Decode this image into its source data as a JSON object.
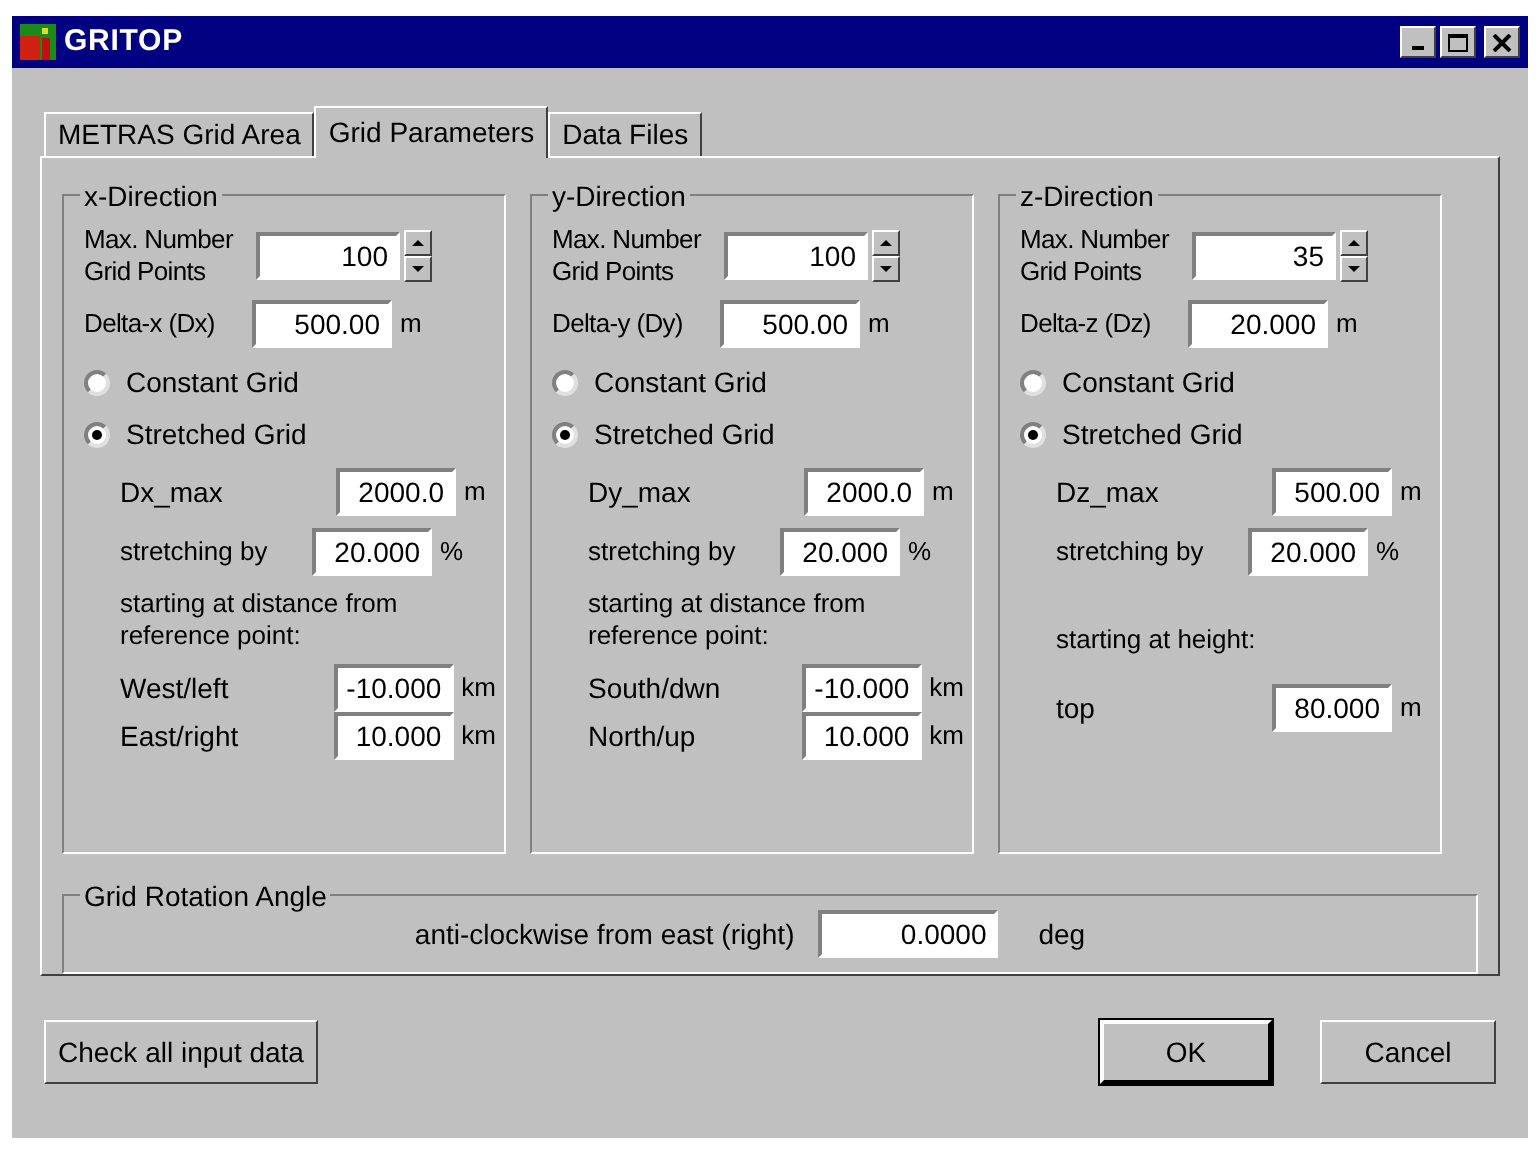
{
  "window": {
    "title": "GRITOP"
  },
  "tabs": [
    {
      "label": "METRAS Grid Area",
      "selected": false
    },
    {
      "label": "Grid Parameters",
      "selected": true
    },
    {
      "label": "Data Files",
      "selected": false
    }
  ],
  "directions": [
    {
      "title": "x-Direction",
      "max_label": "Max. Number Grid Points",
      "max_value": "100",
      "delta_label": "Delta-x (Dx)",
      "delta_value": "500.00",
      "delta_unit": "m",
      "grid_options": [
        {
          "label": "Constant Grid",
          "selected": false
        },
        {
          "label": "Stretched Grid",
          "selected": true
        }
      ],
      "dmax_label": "Dx_max",
      "dmax_value": "2000.0",
      "dmax_unit": "m",
      "stretch_label": "stretching by",
      "stretch_value": "20.000",
      "stretch_unit": "%",
      "start_text": "starting at distance from reference point:",
      "rows": [
        {
          "label": "West/left",
          "value": "-10.000",
          "unit": "km"
        },
        {
          "label": "East/right",
          "value": "10.000",
          "unit": "km"
        }
      ]
    },
    {
      "title": "y-Direction",
      "max_label": "Max. Number Grid Points",
      "max_value": "100",
      "delta_label": "Delta-y (Dy)",
      "delta_value": "500.00",
      "delta_unit": "m",
      "grid_options": [
        {
          "label": "Constant Grid",
          "selected": false
        },
        {
          "label": "Stretched Grid",
          "selected": true
        }
      ],
      "dmax_label": "Dy_max",
      "dmax_value": "2000.0",
      "dmax_unit": "m",
      "stretch_label": "stretching by",
      "stretch_value": "20.000",
      "stretch_unit": "%",
      "start_text": "starting at distance from reference point:",
      "rows": [
        {
          "label": "South/dwn",
          "value": "-10.000",
          "unit": "km"
        },
        {
          "label": "North/up",
          "value": "10.000",
          "unit": "km"
        }
      ]
    },
    {
      "title": "z-Direction",
      "max_label": "Max. Number Grid Points",
      "max_value": "35",
      "delta_label": "Delta-z (Dz)",
      "delta_value": "20.000",
      "delta_unit": "m",
      "grid_options": [
        {
          "label": "Constant Grid",
          "selected": false
        },
        {
          "label": "Stretched Grid",
          "selected": true
        }
      ],
      "dmax_label": "Dz_max",
      "dmax_value": "500.00",
      "dmax_unit": "m",
      "stretch_label": "stretching by",
      "stretch_value": "20.000",
      "stretch_unit": "%",
      "start_text": "starting at height:",
      "rows": [
        {
          "label": "top",
          "value": "80.000",
          "unit": "m"
        }
      ]
    }
  ],
  "rotation": {
    "title": "Grid Rotation Angle",
    "label": "anti-clockwise from east (right)",
    "value": "0.0000",
    "unit": "deg"
  },
  "buttons": {
    "check": "Check all input data",
    "ok": "OK",
    "cancel": "Cancel"
  }
}
